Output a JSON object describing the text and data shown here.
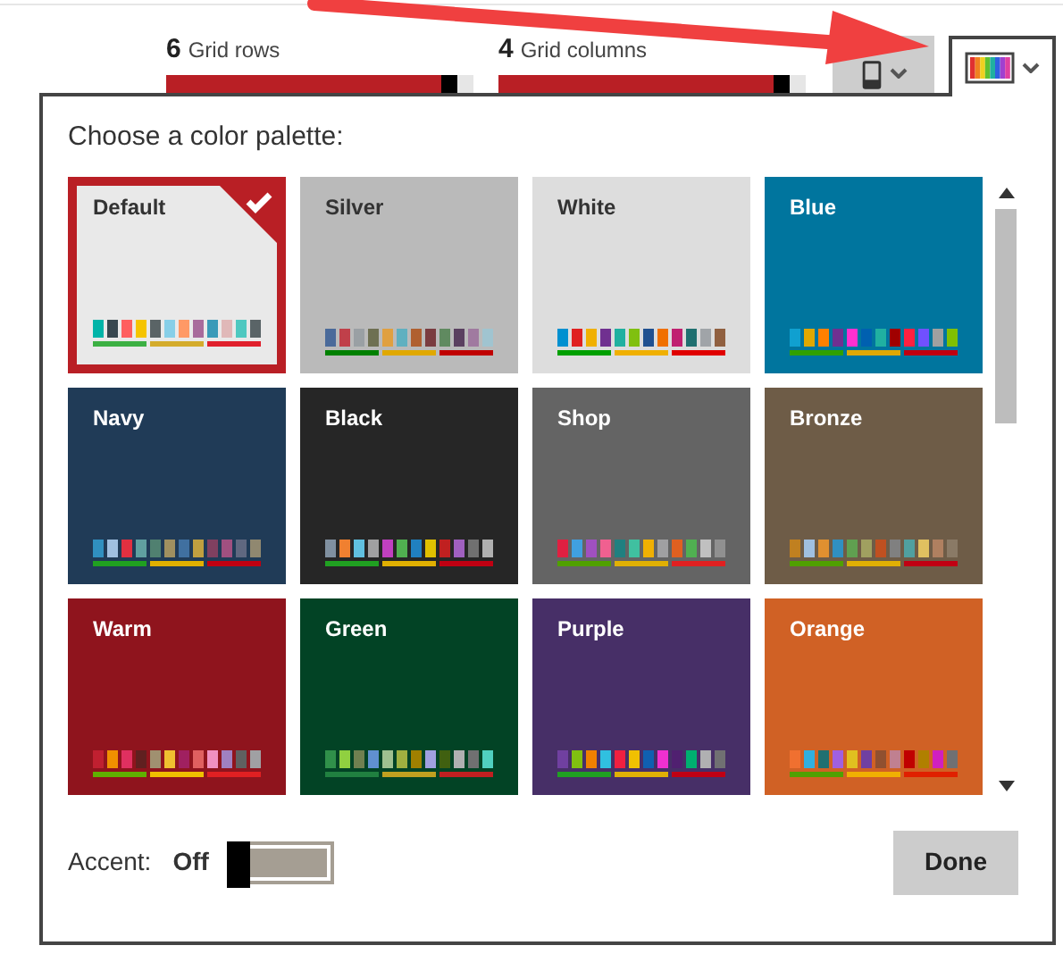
{
  "toolbar": {
    "sliders": [
      {
        "value": "6",
        "label": "Grid rows",
        "level": 0.95
      },
      {
        "value": "4",
        "label": "Grid columns",
        "level": 0.95
      }
    ]
  },
  "palette_panel": {
    "title": "Choose a color palette:",
    "palettes": [
      {
        "name": "Default",
        "color": "#e9e9e9",
        "selected": true,
        "swatches": [
          {
            "color": "#00b4a8"
          },
          {
            "color": "#37474f"
          },
          {
            "color": "#ff5f5f"
          },
          {
            "color": "#f5c400"
          },
          {
            "color": "#5a6466"
          },
          {
            "color": "#87cfe8"
          },
          {
            "color": "#ff9966"
          },
          {
            "color": "#a86b9c"
          },
          {
            "color": "#3a9ab8"
          },
          {
            "color": "#e0b8b8"
          },
          {
            "color": "#4fc8c0"
          },
          {
            "color": "#5a6467"
          }
        ],
        "bars": [
          {
            "color": "#3cb043"
          },
          {
            "color": "#d4ac2c"
          },
          {
            "color": "#e0202c"
          }
        ]
      },
      {
        "name": "Silver",
        "color": "#bababa",
        "selected": false,
        "swatches": [
          {
            "color": "#4a6a9a"
          },
          {
            "color": "#c0404a"
          },
          {
            "color": "#9aa0a4"
          },
          {
            "color": "#6e7052"
          },
          {
            "color": "#e0a040"
          },
          {
            "color": "#60b0c0"
          },
          {
            "color": "#b06030"
          },
          {
            "color": "#7a3c40"
          },
          {
            "color": "#608a60"
          },
          {
            "color": "#5a4060"
          },
          {
            "color": "#a07aa0"
          },
          {
            "color": "#a0c4d0"
          }
        ],
        "bars": [
          {
            "color": "#008000"
          },
          {
            "color": "#e0a800"
          },
          {
            "color": "#c00000"
          }
        ]
      },
      {
        "name": "White",
        "color": "#dddddd",
        "selected": false,
        "swatches": [
          {
            "color": "#0090d0"
          },
          {
            "color": "#e02020"
          },
          {
            "color": "#f0b000"
          },
          {
            "color": "#703090"
          },
          {
            "color": "#20b0a0"
          },
          {
            "color": "#80c010"
          },
          {
            "color": "#205090"
          },
          {
            "color": "#f07000"
          },
          {
            "color": "#c02070"
          },
          {
            "color": "#207070"
          },
          {
            "color": "#a0a4a8"
          },
          {
            "color": "#906040"
          }
        ],
        "bars": [
          {
            "color": "#00a000"
          },
          {
            "color": "#f0b001"
          },
          {
            "color": "#e00000"
          }
        ]
      },
      {
        "name": "Blue",
        "color": "#00759e",
        "selected": false,
        "swatches": [
          {
            "color": "#10a0d0"
          },
          {
            "color": "#e0a801"
          },
          {
            "color": "#ff8000"
          },
          {
            "color": "#703091"
          },
          {
            "color": "#ff30d0"
          },
          {
            "color": "#0060b0"
          },
          {
            "color": "#20b0a1"
          },
          {
            "color": "#a00000"
          },
          {
            "color": "#ff2040"
          },
          {
            "color": "#7050ff"
          },
          {
            "color": "#a0a0a0"
          },
          {
            "color": "#80c000"
          }
        ],
        "bars": [
          {
            "color": "#30a000"
          },
          {
            "color": "#e0a802"
          },
          {
            "color": "#c00010"
          }
        ]
      },
      {
        "name": "Navy",
        "color": "#203b57",
        "selected": false,
        "swatches": [
          {
            "color": "#3090c0"
          },
          {
            "color": "#a0c0e0"
          },
          {
            "color": "#e03040"
          },
          {
            "color": "#60a0a0"
          },
          {
            "color": "#508070"
          },
          {
            "color": "#a09060"
          },
          {
            "color": "#4070a0"
          },
          {
            "color": "#c0a040"
          },
          {
            "color": "#804060"
          },
          {
            "color": "#a05080"
          },
          {
            "color": "#606880"
          },
          {
            "color": "#908870"
          }
        ],
        "bars": [
          {
            "color": "#20a020"
          },
          {
            "color": "#e0b000"
          },
          {
            "color": "#c00011"
          }
        ]
      },
      {
        "name": "Black",
        "color": "#262626",
        "selected": false,
        "swatches": [
          {
            "color": "#8090a0"
          },
          {
            "color": "#f08030"
          },
          {
            "color": "#60c0e0"
          },
          {
            "color": "#a0a0a1"
          },
          {
            "color": "#c040c0"
          },
          {
            "color": "#50b050"
          },
          {
            "color": "#2080c0"
          },
          {
            "color": "#e0c000"
          },
          {
            "color": "#c02020"
          },
          {
            "color": "#a060c0"
          },
          {
            "color": "#707070"
          },
          {
            "color": "#b0b0b0"
          }
        ],
        "bars": [
          {
            "color": "#20a021"
          },
          {
            "color": "#e0b002"
          },
          {
            "color": "#c00012"
          }
        ]
      },
      {
        "name": "Shop",
        "color": "#646464",
        "selected": false,
        "swatches": [
          {
            "color": "#e02041"
          },
          {
            "color": "#40a0e0"
          },
          {
            "color": "#a050c0"
          },
          {
            "color": "#f06090"
          },
          {
            "color": "#208080"
          },
          {
            "color": "#40c0a0"
          },
          {
            "color": "#f0b003"
          },
          {
            "color": "#a0a0a2"
          },
          {
            "color": "#e06020"
          },
          {
            "color": "#50b051"
          },
          {
            "color": "#c0c0c0"
          },
          {
            "color": "#909090"
          }
        ],
        "bars": [
          {
            "color": "#50a000"
          },
          {
            "color": "#e0b004"
          },
          {
            "color": "#e02021"
          }
        ]
      },
      {
        "name": "Bronze",
        "color": "#6e5c47",
        "selected": false,
        "swatches": [
          {
            "color": "#c08020"
          },
          {
            "color": "#a0c0e1"
          },
          {
            "color": "#e09030"
          },
          {
            "color": "#3090c1"
          },
          {
            "color": "#60a050"
          },
          {
            "color": "#a0a060"
          },
          {
            "color": "#c05020"
          },
          {
            "color": "#808080"
          },
          {
            "color": "#50a0a0"
          },
          {
            "color": "#e0c060"
          },
          {
            "color": "#b08060"
          },
          {
            "color": "#8a7a66"
          }
        ],
        "bars": [
          {
            "color": "#50a001"
          },
          {
            "color": "#e0b005"
          },
          {
            "color": "#c00013"
          }
        ]
      },
      {
        "name": "Warm",
        "color": "#8f141d",
        "selected": false,
        "swatches": [
          {
            "color": "#c02030"
          },
          {
            "color": "#f09000"
          },
          {
            "color": "#e03060"
          },
          {
            "color": "#602020"
          },
          {
            "color": "#a09070"
          },
          {
            "color": "#f0c030"
          },
          {
            "color": "#a02060"
          },
          {
            "color": "#e06060"
          },
          {
            "color": "#f090c0"
          },
          {
            "color": "#a080c0"
          },
          {
            "color": "#606060"
          },
          {
            "color": "#a0a0a3"
          }
        ],
        "bars": [
          {
            "color": "#60b000"
          },
          {
            "color": "#f0c000"
          },
          {
            "color": "#e02022"
          }
        ]
      },
      {
        "name": "Green",
        "color": "#024325",
        "selected": false,
        "swatches": [
          {
            "color": "#30904a"
          },
          {
            "color": "#90d040"
          },
          {
            "color": "#708050"
          },
          {
            "color": "#6090d0"
          },
          {
            "color": "#a0c090"
          },
          {
            "color": "#a0b040"
          },
          {
            "color": "#a08000"
          },
          {
            "color": "#a0a0e0"
          },
          {
            "color": "#406010"
          },
          {
            "color": "#b0b0b1"
          },
          {
            "color": "#707071"
          },
          {
            "color": "#50d0c0"
          }
        ],
        "bars": [
          {
            "color": "#208040"
          },
          {
            "color": "#c0a020"
          },
          {
            "color": "#c02021"
          }
        ]
      },
      {
        "name": "Purple",
        "color": "#472f67",
        "selected": false,
        "swatches": [
          {
            "color": "#7040a0"
          },
          {
            "color": "#80c010"
          },
          {
            "color": "#f08000"
          },
          {
            "color": "#30c0e0"
          },
          {
            "color": "#f02040"
          },
          {
            "color": "#f0c001"
          },
          {
            "color": "#1060b0"
          },
          {
            "color": "#f030d0"
          },
          {
            "color": "#502070"
          },
          {
            "color": "#00b070"
          },
          {
            "color": "#b0b0b2"
          },
          {
            "color": "#707072"
          }
        ],
        "bars": [
          {
            "color": "#20a022"
          },
          {
            "color": "#e0b006"
          },
          {
            "color": "#c00014"
          }
        ]
      },
      {
        "name": "Orange",
        "color": "#d06125",
        "selected": false,
        "swatches": [
          {
            "color": "#f07030"
          },
          {
            "color": "#30b0e0"
          },
          {
            "color": "#207071"
          },
          {
            "color": "#a060e0"
          },
          {
            "color": "#e0c020"
          },
          {
            "color": "#7040a1"
          },
          {
            "color": "#905030"
          },
          {
            "color": "#c08090"
          },
          {
            "color": "#c00000"
          },
          {
            "color": "#b08000"
          },
          {
            "color": "#d020c0"
          },
          {
            "color": "#707073"
          }
        ],
        "bars": [
          {
            "color": "#50a002"
          },
          {
            "color": "#f0b002"
          },
          {
            "color": "#e02000"
          }
        ]
      }
    ],
    "accent": {
      "label": "Accent:",
      "state_text": "Off",
      "on": false
    },
    "done_button": "Done"
  }
}
